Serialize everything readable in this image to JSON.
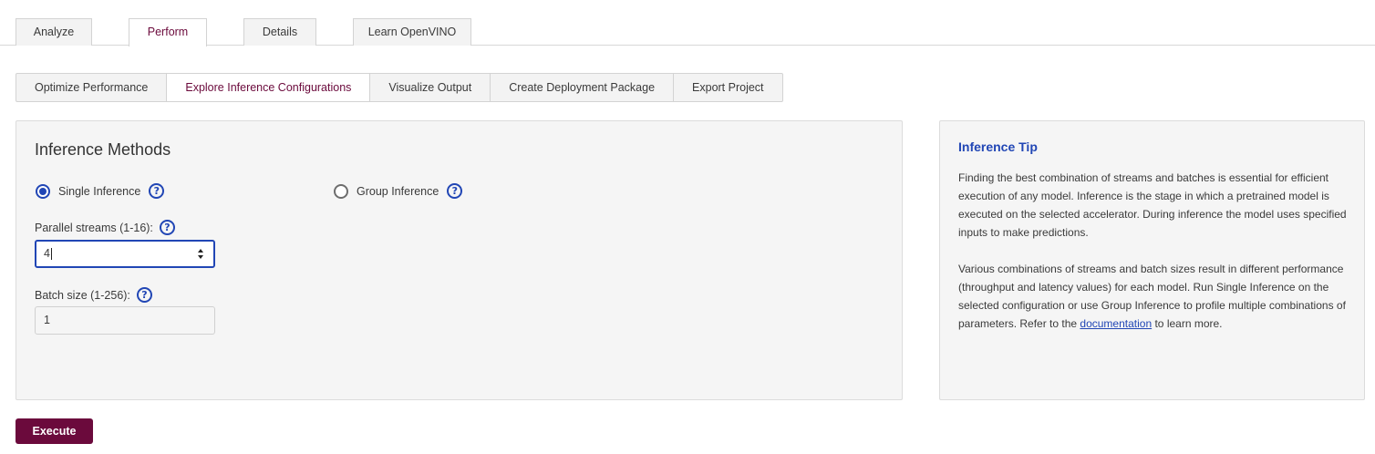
{
  "top_tabs": {
    "analyze": "Analyze",
    "perform": "Perform",
    "details": "Details",
    "learn": "Learn OpenVINO",
    "active": "Perform"
  },
  "sub_tabs": {
    "optimize": "Optimize Performance",
    "explore": "Explore Inference Configurations",
    "visualize": "Visualize Output",
    "deploy": "Create Deployment Package",
    "export": "Export Project",
    "active": "Explore Inference Configurations"
  },
  "inference_methods": {
    "title": "Inference Methods",
    "single_label": "Single Inference",
    "group_label": "Group Inference",
    "selected": "Single Inference",
    "help_glyph": "?",
    "parallel_streams_label": "Parallel streams (1-16):",
    "parallel_streams_value": "4",
    "batch_size_label": "Batch size (1-256):",
    "batch_size_value": "1"
  },
  "tip": {
    "title": "Inference Tip",
    "para1": "Finding the best combination of streams and batches is essential for efficient execution of any model. Inference is the stage in which a pretrained model is executed on the selected accelerator. During inference the model uses specified inputs to make predictions.",
    "para2_before": "Various combinations of streams and batch sizes result in different performance (throughput and latency values) for each model. Run Single Inference on the selected configuration or use Group Inference to profile multiple combinations of parameters. Refer to the ",
    "link": "documentation",
    "para2_after": " to learn more."
  },
  "execute_label": "Execute",
  "colors": {
    "accent": "#6b0a3c",
    "link": "#2146b5",
    "panel_bg": "#f5f5f5"
  },
  "icons": {
    "help": "question-circle-icon",
    "spinner": "number-spinner-icon"
  }
}
